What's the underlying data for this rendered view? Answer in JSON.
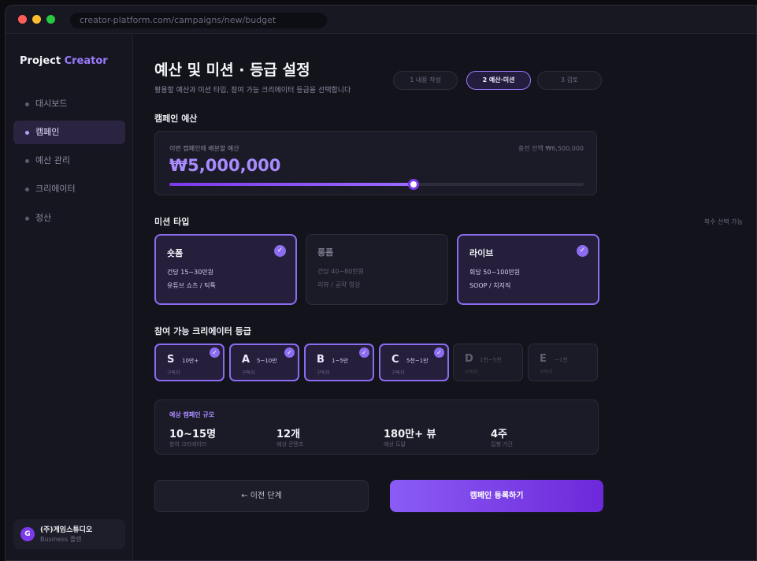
{
  "browser": {
    "url": "creator-platform.com/campaigns/new/budget"
  },
  "sidebar": {
    "brand_prefix": "Project",
    "brand_accent": "Creator",
    "items": [
      {
        "label": "대시보드"
      },
      {
        "label": "캠페인"
      },
      {
        "label": "예산 관리"
      },
      {
        "label": "크리에이터"
      },
      {
        "label": "정산"
      }
    ],
    "active_index": 1,
    "account": {
      "initial": "G",
      "name": "(주)게임스튜디오",
      "plan": "Business 플랜"
    }
  },
  "header": {
    "title": "예산 및 미션 · 등급 설정",
    "subtitle": "활용할 예산과 미션 타입, 참여 가능 크리에이터 등급을 선택합니다",
    "steps": [
      {
        "label": "1 내용 작성",
        "active": false
      },
      {
        "label": "2 예산·미션",
        "active": true
      },
      {
        "label": "3 검토",
        "active": false
      }
    ]
  },
  "budget": {
    "section_label": "캠페인 예산",
    "label": "이번 캠페인에 배분할 예산",
    "balance": "충전 잔액 ₩6,500,000",
    "amount": "₩5,000,000",
    "slider_fraction": 0.59
  },
  "missions": {
    "section_label": "미션 타입",
    "hint": "복수 선택 가능",
    "items": [
      {
        "title": "숏폼",
        "line1": "건당 15~30만원",
        "line2": "유튜브 쇼츠 / 틱톡",
        "selected": true
      },
      {
        "title": "롱폼",
        "line1": "건당 40~80만원",
        "line2": "리뷰 / 공략 영상",
        "selected": false
      },
      {
        "title": "라이브",
        "line1": "회당 50~100만원",
        "line2": "SOOP / 치지직",
        "selected": true
      }
    ]
  },
  "tiers": {
    "section_label": "참여 가능 크리에이터 등급",
    "items": [
      {
        "letter": "S",
        "range": "10만+",
        "unit": "구독자",
        "selected": true
      },
      {
        "letter": "A",
        "range": "5~10만",
        "unit": "구독자",
        "selected": true
      },
      {
        "letter": "B",
        "range": "1~5만",
        "unit": "구독자",
        "selected": true
      },
      {
        "letter": "C",
        "range": "5천~1만",
        "unit": "구독자",
        "selected": true
      },
      {
        "letter": "D",
        "range": "1천~5천",
        "unit": "구독자",
        "selected": false
      },
      {
        "letter": "E",
        "range": "~1천",
        "unit": "구독자",
        "selected": false
      }
    ]
  },
  "scale": {
    "title": "예상 캠페인 규모",
    "stats": [
      {
        "value": "10~15명",
        "label": "참여 크리에이터"
      },
      {
        "value": "12개",
        "label": "예상 콘텐츠"
      },
      {
        "value": "180만+ 뷰",
        "label": "예상 도달"
      },
      {
        "value": "4주",
        "label": "집행 기간"
      }
    ]
  },
  "actions": {
    "prev_label": "← 이전 단계",
    "submit_label": "캠페인 등록하기"
  },
  "check_glyph": "✓",
  "colors": {
    "accent": "#8c6cf0",
    "brand_accent": "#9b7bff",
    "submit_from": "#8b5cf6",
    "submit_to": "#6d28d9"
  }
}
